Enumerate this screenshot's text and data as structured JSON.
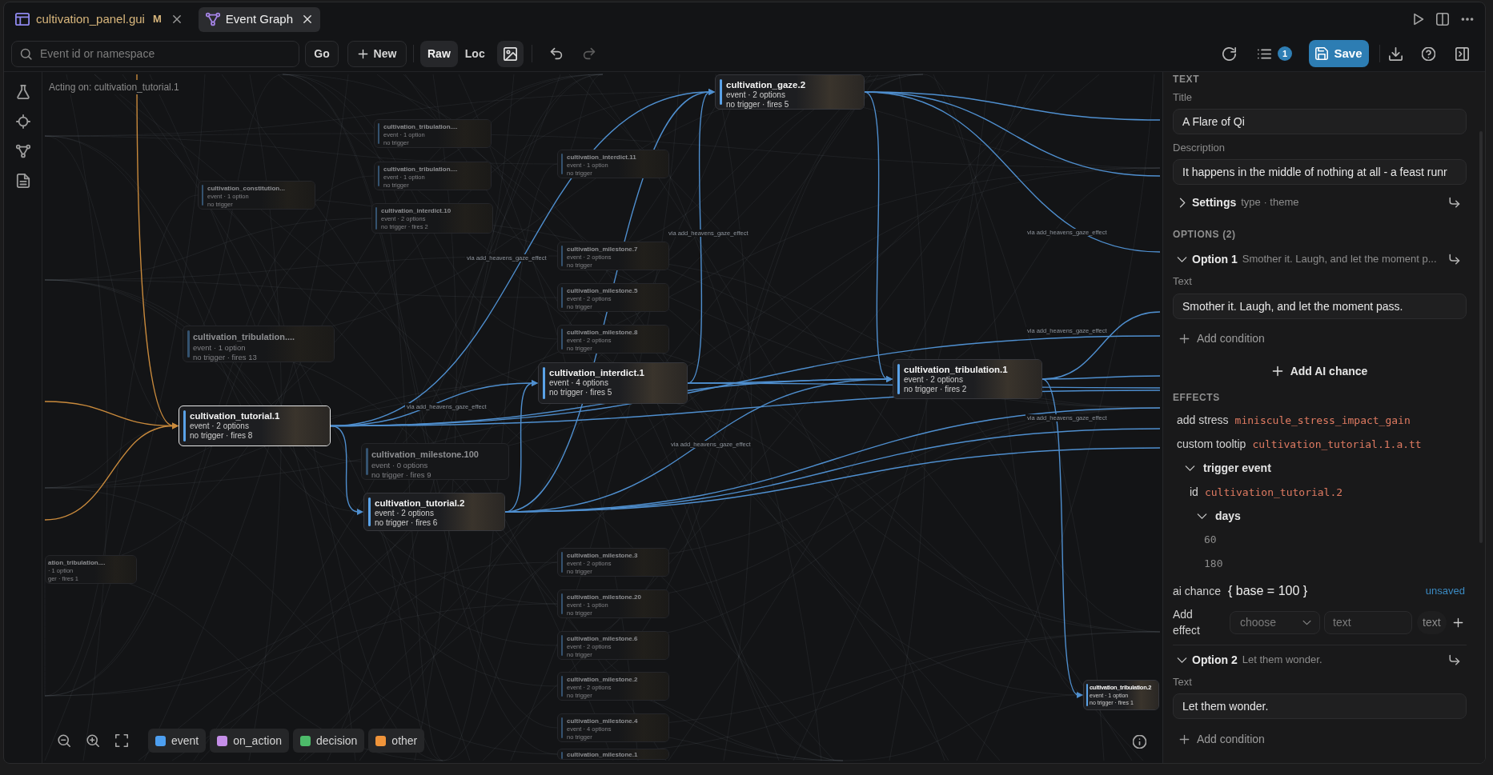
{
  "tabs": [
    {
      "label": "cultivation_panel.gui",
      "kind": "file",
      "modified": true,
      "badge": "M",
      "selected": false
    },
    {
      "label": "Event Graph",
      "kind": "graph",
      "modified": false,
      "selected": true
    }
  ],
  "toolbar": {
    "search": {
      "placeholder": "Event id or namespace"
    },
    "go_button": "Go",
    "new_button": "New",
    "modes": [
      {
        "label": "Raw",
        "selected": true
      },
      {
        "label": "Loc",
        "selected": false
      }
    ],
    "images_on": true,
    "can_undo": true,
    "can_redo": false,
    "queue_count": "1",
    "save_button": "Save"
  },
  "canvas": {
    "acting_on": "Acting on: cultivation_tutorial.1",
    "nodes": [
      {
        "title": "cultivation_gaze.2",
        "summary": "event · 2 options",
        "status": "no trigger · fires 5",
        "thumbnail": true,
        "dimmed": false,
        "selected": false
      },
      {
        "title": "cultivation_tribulation....",
        "summary": "event · 1 option",
        "status": "no trigger",
        "thumbnail": true,
        "dimmed": true,
        "selected": false
      },
      {
        "title": "cultivation_interdict.11",
        "summary": "event · 1 option",
        "status": "no trigger",
        "thumbnail": true,
        "dimmed": true,
        "selected": false
      },
      {
        "title": "cultivation_tribulation....",
        "summary": "event · 1 option",
        "status": "no trigger",
        "thumbnail": true,
        "dimmed": true,
        "selected": false
      },
      {
        "title": "cultivation_constitution...",
        "summary": "event · 1 option",
        "status": "no trigger",
        "thumbnail": true,
        "dimmed": true,
        "selected": false
      },
      {
        "title": "cultivation_interdict.10",
        "summary": "event · 2 options",
        "status": "no trigger · fires 2",
        "thumbnail": true,
        "dimmed": true,
        "selected": false
      },
      {
        "title": "cultivation_milestone.7",
        "summary": "event · 2 options",
        "status": "no trigger",
        "thumbnail": true,
        "dimmed": true,
        "selected": false
      },
      {
        "title": "cultivation_milestone.5",
        "summary": "event · 2 options",
        "status": "no trigger",
        "thumbnail": true,
        "dimmed": true,
        "selected": false
      },
      {
        "title": "cultivation_tribulation....",
        "summary": "event · 1 option",
        "status": "no trigger · fires 13",
        "thumbnail": true,
        "dimmed": true,
        "selected": false
      },
      {
        "title": "cultivation_milestone.8",
        "summary": "event · 2 options",
        "status": "no trigger",
        "thumbnail": true,
        "dimmed": true,
        "selected": false
      },
      {
        "title": "cultivation_interdict.1",
        "summary": "event · 4 options",
        "status": "no trigger · fires 5",
        "thumbnail": true,
        "dimmed": false,
        "selected": false
      },
      {
        "title": "cultivation_tribulation.1",
        "summary": "event · 2 options",
        "status": "no trigger · fires 2",
        "thumbnail": true,
        "dimmed": false,
        "selected": false
      },
      {
        "title": "cultivation_tutorial.1",
        "summary": "event · 2 options",
        "status": "no trigger · fires 8",
        "thumbnail": true,
        "dimmed": false,
        "selected": true
      },
      {
        "title": "cultivation_milestone.100",
        "summary": "event · 0 options",
        "status": "no trigger · fires 9",
        "thumbnail": false,
        "dimmed": true,
        "selected": false
      },
      {
        "title": "cultivation_tutorial.2",
        "summary": "event · 2 options",
        "status": "no trigger · fires 6",
        "thumbnail": true,
        "dimmed": false,
        "selected": false
      },
      {
        "title": "ation_tribulation....",
        "summary": "· 1 option",
        "status": "ger · fires 1",
        "thumbnail": true,
        "dimmed": true,
        "selected": false
      },
      {
        "title": "cultivation_milestone.3",
        "summary": "event · 2 options",
        "status": "no trigger",
        "thumbnail": true,
        "dimmed": true,
        "selected": false
      },
      {
        "title": "cultivation_milestone.20",
        "summary": "event · 1 option",
        "status": "no trigger",
        "thumbnail": true,
        "dimmed": true,
        "selected": false
      },
      {
        "title": "cultivation_milestone.6",
        "summary": "event · 2 options",
        "status": "no trigger",
        "thumbnail": true,
        "dimmed": true,
        "selected": false
      },
      {
        "title": "cultivation_milestone.2",
        "summary": "event · 2 options",
        "status": "no trigger",
        "thumbnail": true,
        "dimmed": true,
        "selected": false
      },
      {
        "title": "cultivation_tribulation.2",
        "summary": "event · 1 option",
        "status": "no trigger · fires 1",
        "thumbnail": true,
        "dimmed": false,
        "selected": false
      },
      {
        "title": "cultivation_milestone.4",
        "summary": "event · 4 options",
        "status": "no trigger",
        "thumbnail": true,
        "dimmed": true,
        "selected": false
      },
      {
        "title": "cultivation_milestone.1",
        "thumbnail": true,
        "dimmed": true,
        "selected": false
      }
    ],
    "edge_labels": [
      "via add_heavens_gaze_effect",
      "via add_heavens_gaze_effect",
      "via add_heavens_gaze_effect",
      "via add_heavens_gaze_effect",
      "via add_heavens_gaze_effect",
      "via add_heavens_gaze_effect",
      "via add_heavens_gaze_effect"
    ],
    "legend": [
      {
        "label": "event",
        "color": "#4d9ff0"
      },
      {
        "label": "on_action",
        "color": "#c58ee8"
      },
      {
        "label": "decision",
        "color": "#4dbb6a"
      },
      {
        "label": "other",
        "color": "#f0943a"
      }
    ]
  },
  "panel": {
    "text_heading": "TEXT",
    "fields": [
      {
        "label": "Title",
        "value": "A Flare of Qi"
      },
      {
        "label": "Description",
        "value": "It happens in the middle of nothing at all - a feast runr"
      }
    ],
    "settings": {
      "label": "Settings",
      "summary": "type · theme",
      "expanded": false
    },
    "options_heading": "OPTIONS (2)",
    "options": [
      {
        "label": "Option 1",
        "summary": "Smother it. Laugh, and let the moment p...",
        "expanded": true,
        "text_label": "Text",
        "text_value": "Smother it. Laugh, and let the moment pass.",
        "add_condition": "Add condition",
        "add_ai_chance": "Add AI chance",
        "effects_heading": "EFFECTS",
        "effects": [
          {
            "kind": "pair",
            "key": "add stress",
            "value": "miniscule_stress_impact_gain"
          },
          {
            "kind": "pair",
            "key": "custom tooltip",
            "value": "cultivation_tutorial.1.a.tt"
          },
          {
            "kind": "block",
            "key": "trigger event",
            "expanded": true,
            "children": [
              {
                "kind": "pair",
                "key": "id",
                "value": "cultivation_tutorial.2"
              },
              {
                "kind": "list",
                "key": "days",
                "expanded": true,
                "items": [
                  "60",
                  "180"
                ]
              }
            ]
          }
        ],
        "ai_chance": {
          "label": "ai chance",
          "value": "{ base = 100 }",
          "status": "unsaved"
        },
        "add_effect": {
          "label": "Add effect",
          "select_placeholder": "choose",
          "value_placeholder": "text",
          "type_chip": "text"
        }
      },
      {
        "label": "Option 2",
        "summary": "Let them wonder.",
        "expanded": true,
        "text_label": "Text",
        "text_value": "Let them wonder.",
        "add_condition": "Add condition"
      }
    ]
  }
}
